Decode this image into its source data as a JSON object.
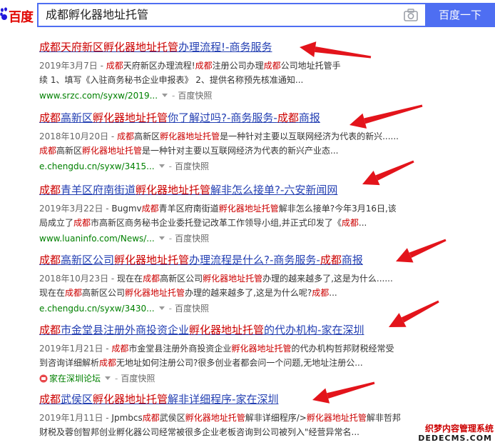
{
  "header": {
    "logo_text": "百度",
    "query": "成都孵化器地址托管",
    "search_button": "百度一下"
  },
  "results": [
    {
      "title_parts": [
        {
          "t": "成都天府新区",
          "hl": true
        },
        {
          "t": "孵化器地址托管",
          "hl": true
        },
        {
          "t": "办理流程!-商务服务",
          "hl": false
        }
      ],
      "snippet_lines": [
        [
          {
            "t": "2019年3月7日 - ",
            "c": "date"
          },
          {
            "t": "成都",
            "c": "em"
          },
          {
            "t": "天府新区办理流程!",
            "c": ""
          },
          {
            "t": "成都",
            "c": "em"
          },
          {
            "t": "注册公司办理",
            "c": ""
          },
          {
            "t": "成都",
            "c": "em"
          },
          {
            "t": "公司地址托管手",
            "c": ""
          }
        ],
        [
          {
            "t": "续 1、填写《入驻商务秘书企业申报表》 2、提供名称预先核准通知...",
            "c": ""
          }
        ]
      ],
      "url": "www.srzc.com/syxw/2019...",
      "snapshot": "百度快照"
    },
    {
      "title_parts": [
        {
          "t": "成都",
          "hl": true
        },
        {
          "t": "高新区",
          "hl": false
        },
        {
          "t": "孵化器地址托管",
          "hl": true
        },
        {
          "t": "你了解过吗?-商务服务-",
          "hl": false
        },
        {
          "t": "成都",
          "hl": true
        },
        {
          "t": "商报",
          "hl": false
        }
      ],
      "snippet_lines": [
        [
          {
            "t": "2018年10月20日 - ",
            "c": "date"
          },
          {
            "t": "成都",
            "c": "em"
          },
          {
            "t": "高新区",
            "c": ""
          },
          {
            "t": "孵化器地址托管",
            "c": "em"
          },
          {
            "t": "是一种针对主要以互联网经济为代表的新兴......",
            "c": ""
          }
        ],
        [
          {
            "t": "成都",
            "c": "em"
          },
          {
            "t": "高新区",
            "c": ""
          },
          {
            "t": "孵化器地址托管",
            "c": "em"
          },
          {
            "t": "是一种针对主要以互联网经济为代表的新兴产业态...",
            "c": ""
          }
        ]
      ],
      "url": "e.chengdu.cn/syxw/3415...",
      "snapshot": "百度快照"
    },
    {
      "title_parts": [
        {
          "t": "成都",
          "hl": true
        },
        {
          "t": "青羊区府南街道",
          "hl": false
        },
        {
          "t": "孵化器地址托管",
          "hl": true
        },
        {
          "t": "解非怎么接单?-六安新闻网",
          "hl": false
        }
      ],
      "snippet_lines": [
        [
          {
            "t": "2019年3月22日 - ",
            "c": "date"
          },
          {
            "t": "Bugmv",
            "c": ""
          },
          {
            "t": "成都",
            "c": "em"
          },
          {
            "t": "青羊区府南街道",
            "c": ""
          },
          {
            "t": "孵化器地址托管",
            "c": "em"
          },
          {
            "t": "解非怎么接单?今年3月16日,该",
            "c": ""
          }
        ],
        [
          {
            "t": "局成立了",
            "c": ""
          },
          {
            "t": "成都",
            "c": "em"
          },
          {
            "t": "市高新区商务秘书企业委托登记改革工作领导小组,并正式印发了《",
            "c": ""
          },
          {
            "t": "成都",
            "c": "em"
          },
          {
            "t": "...",
            "c": ""
          }
        ]
      ],
      "url": "www.luaninfo.com/News/...",
      "snapshot": "百度快照"
    },
    {
      "title_parts": [
        {
          "t": "成都",
          "hl": true
        },
        {
          "t": "高新区公司",
          "hl": false
        },
        {
          "t": "孵化器地址托管",
          "hl": true
        },
        {
          "t": "办理流程是什么?-商务服务-",
          "hl": false
        },
        {
          "t": "成都",
          "hl": true
        },
        {
          "t": "商报",
          "hl": false
        }
      ],
      "snippet_lines": [
        [
          {
            "t": "2018年10月23日 - ",
            "c": "date"
          },
          {
            "t": "现在在",
            "c": ""
          },
          {
            "t": "成都",
            "c": "em"
          },
          {
            "t": "高新区公司",
            "c": ""
          },
          {
            "t": "孵化器地址托管",
            "c": "em"
          },
          {
            "t": "办理的越来越多了,这是为什么......",
            "c": ""
          }
        ],
        [
          {
            "t": "现在在",
            "c": ""
          },
          {
            "t": "成都",
            "c": "em"
          },
          {
            "t": "高新区公司",
            "c": ""
          },
          {
            "t": "孵化器地址托管",
            "c": "em"
          },
          {
            "t": "办理的越来越多了,这是为什么呢?",
            "c": ""
          },
          {
            "t": "成都",
            "c": "em"
          },
          {
            "t": "...",
            "c": ""
          }
        ]
      ],
      "url": "e.chengdu.cn/syxw/3430...",
      "snapshot": "百度快照"
    },
    {
      "title_parts": [
        {
          "t": "成都",
          "hl": true
        },
        {
          "t": "市金堂县注册外商投资企业",
          "hl": false
        },
        {
          "t": "孵化器地址托管",
          "hl": true
        },
        {
          "t": "的代办机构-家在深圳",
          "hl": false
        }
      ],
      "snippet_lines": [
        [
          {
            "t": "2019年1月21日 - ",
            "c": "date"
          },
          {
            "t": "成都",
            "c": "em"
          },
          {
            "t": "市金堂县注册外商投资企业",
            "c": ""
          },
          {
            "t": "孵化器地址托管",
            "c": "em"
          },
          {
            "t": "的代办机构哲邦财税经常受",
            "c": ""
          }
        ],
        [
          {
            "t": "到咨询详细解析",
            "c": ""
          },
          {
            "t": "成都",
            "c": "em"
          },
          {
            "t": "无地址如何注册公司?很多创业者都会问一个问题,无地址注册公...",
            "c": ""
          }
        ]
      ],
      "url": "家在深圳论坛",
      "snapshot": "百度快照"
    },
    {
      "title_parts": [
        {
          "t": "成都",
          "hl": true
        },
        {
          "t": "武侯区",
          "hl": false
        },
        {
          "t": "孵化器地址托管",
          "hl": true
        },
        {
          "t": "解非详细程序-家在深圳",
          "hl": false
        }
      ],
      "snippet_lines": [
        [
          {
            "t": "2019年1月11日 - ",
            "c": "date"
          },
          {
            "t": "Jpmbcs",
            "c": ""
          },
          {
            "t": "成都",
            "c": "em"
          },
          {
            "t": "武侯区",
            "c": ""
          },
          {
            "t": "孵化器地址托管",
            "c": "em"
          },
          {
            "t": "解非详细程序/>",
            "c": ""
          },
          {
            "t": "孵化器地址托管",
            "c": "em"
          },
          {
            "t": "解非哲邦",
            "c": ""
          }
        ],
        [
          {
            "t": "财税及蓉创智邦创业孵化器公司经常被很多企业老板咨询到公司被列入\"经营异常名...",
            "c": ""
          }
        ]
      ],
      "url": "",
      "snapshot": ""
    }
  ],
  "watermark": {
    "line1": "织梦内容管理系统",
    "line2": "DEDECMS.COM"
  },
  "colors": {
    "accent": "#4e6ef2",
    "logo_red": "#e10602",
    "highlight_red": "#c00000",
    "link_blue": "#2440b3",
    "url_green": "#008000",
    "arrow_red": "#e3141b"
  }
}
